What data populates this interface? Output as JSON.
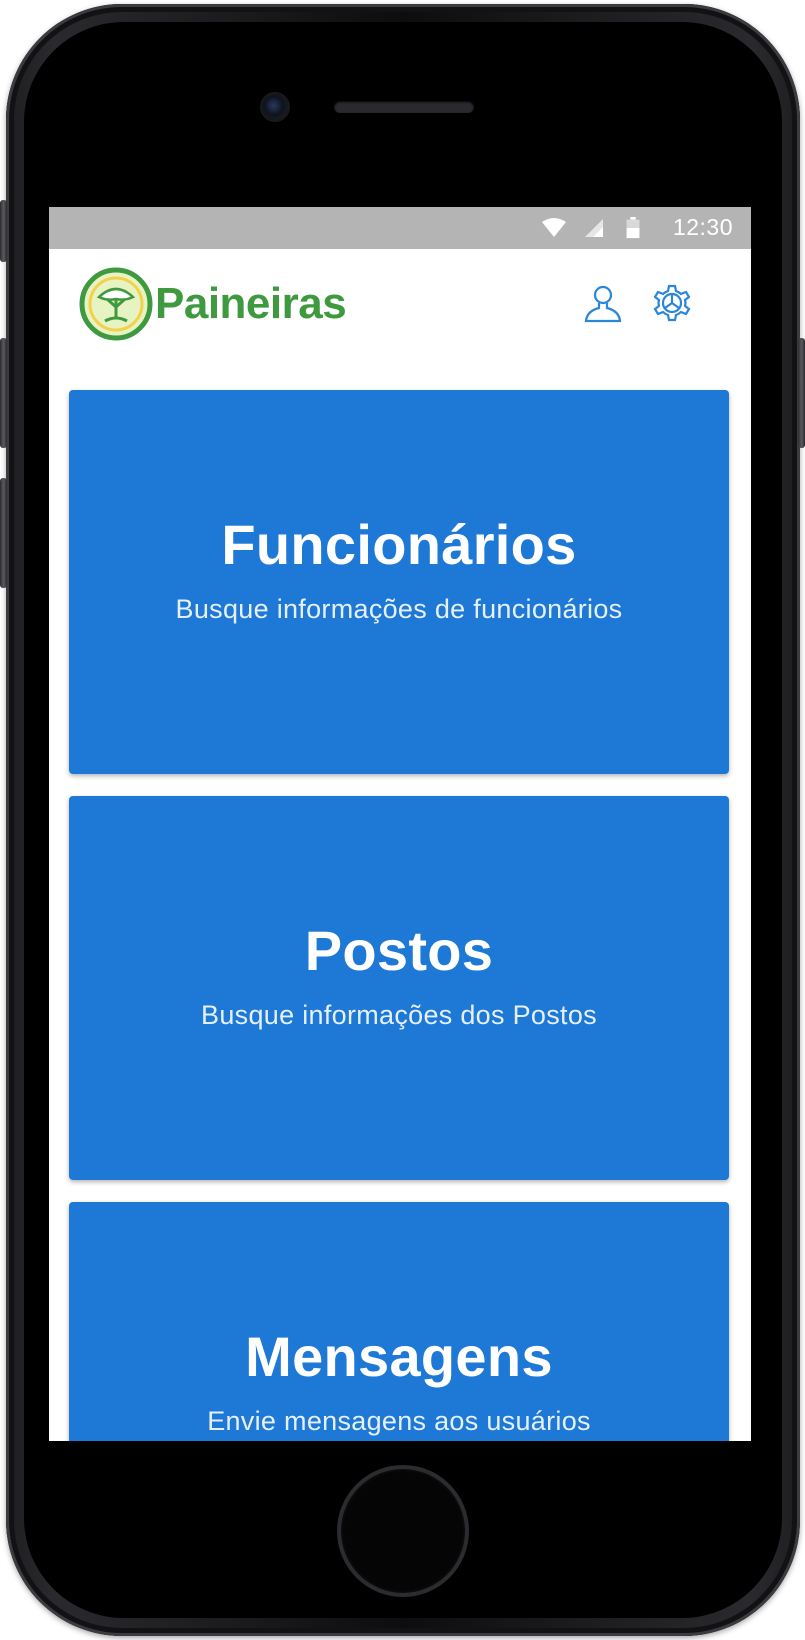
{
  "status_bar": {
    "time": "12:30",
    "icons": [
      "wifi-icon",
      "signal-icon",
      "battery-icon"
    ]
  },
  "header": {
    "logo_text": "Paineiras",
    "icons": [
      "user-icon",
      "settings-gear-icon"
    ]
  },
  "cards": [
    {
      "title": "Funcionários",
      "subtitle": "Busque informações de funcionários"
    },
    {
      "title": "Postos",
      "subtitle": "Busque informações dos Postos"
    },
    {
      "title": "Mensagens",
      "subtitle": "Envie mensagens aos usuários"
    }
  ],
  "colors": {
    "card_blue": "#1e78d6",
    "brand_green": "#3f9a3f",
    "icon_blue": "#2a86d8",
    "status_bar_gray": "#b4b4b4"
  }
}
